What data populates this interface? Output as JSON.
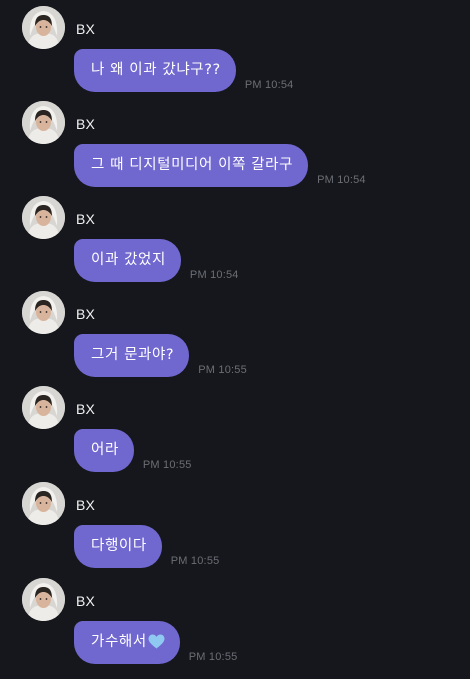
{
  "colors": {
    "background": "#15171c",
    "bubble": "#7067cf",
    "bubble_text": "#ffffff",
    "timestamp": "#6c6e75",
    "heart": "#8fc8f0"
  },
  "messages": [
    {
      "sender": "BX",
      "text": "나 왜 이과 갔냐구??",
      "time": "PM 10:54",
      "avatar_icon": "profile-photo"
    },
    {
      "sender": "BX",
      "text": "그 때 디지털미디어 이쪽 갈라구",
      "time": "PM 10:54",
      "avatar_icon": "profile-photo"
    },
    {
      "sender": "BX",
      "text": "이과 갔었지",
      "time": "PM 10:54",
      "avatar_icon": "profile-photo"
    },
    {
      "sender": "BX",
      "text": "그거 문과야?",
      "time": "PM 10:55",
      "avatar_icon": "profile-photo"
    },
    {
      "sender": "BX",
      "text": "어라",
      "time": "PM 10:55",
      "avatar_icon": "profile-photo"
    },
    {
      "sender": "BX",
      "text": "다행이다",
      "time": "PM 10:55",
      "avatar_icon": "profile-photo"
    },
    {
      "sender": "BX",
      "text": "가수해서",
      "time": "PM 10:55",
      "avatar_icon": "profile-photo",
      "emoji": "blue-heart-icon"
    }
  ]
}
